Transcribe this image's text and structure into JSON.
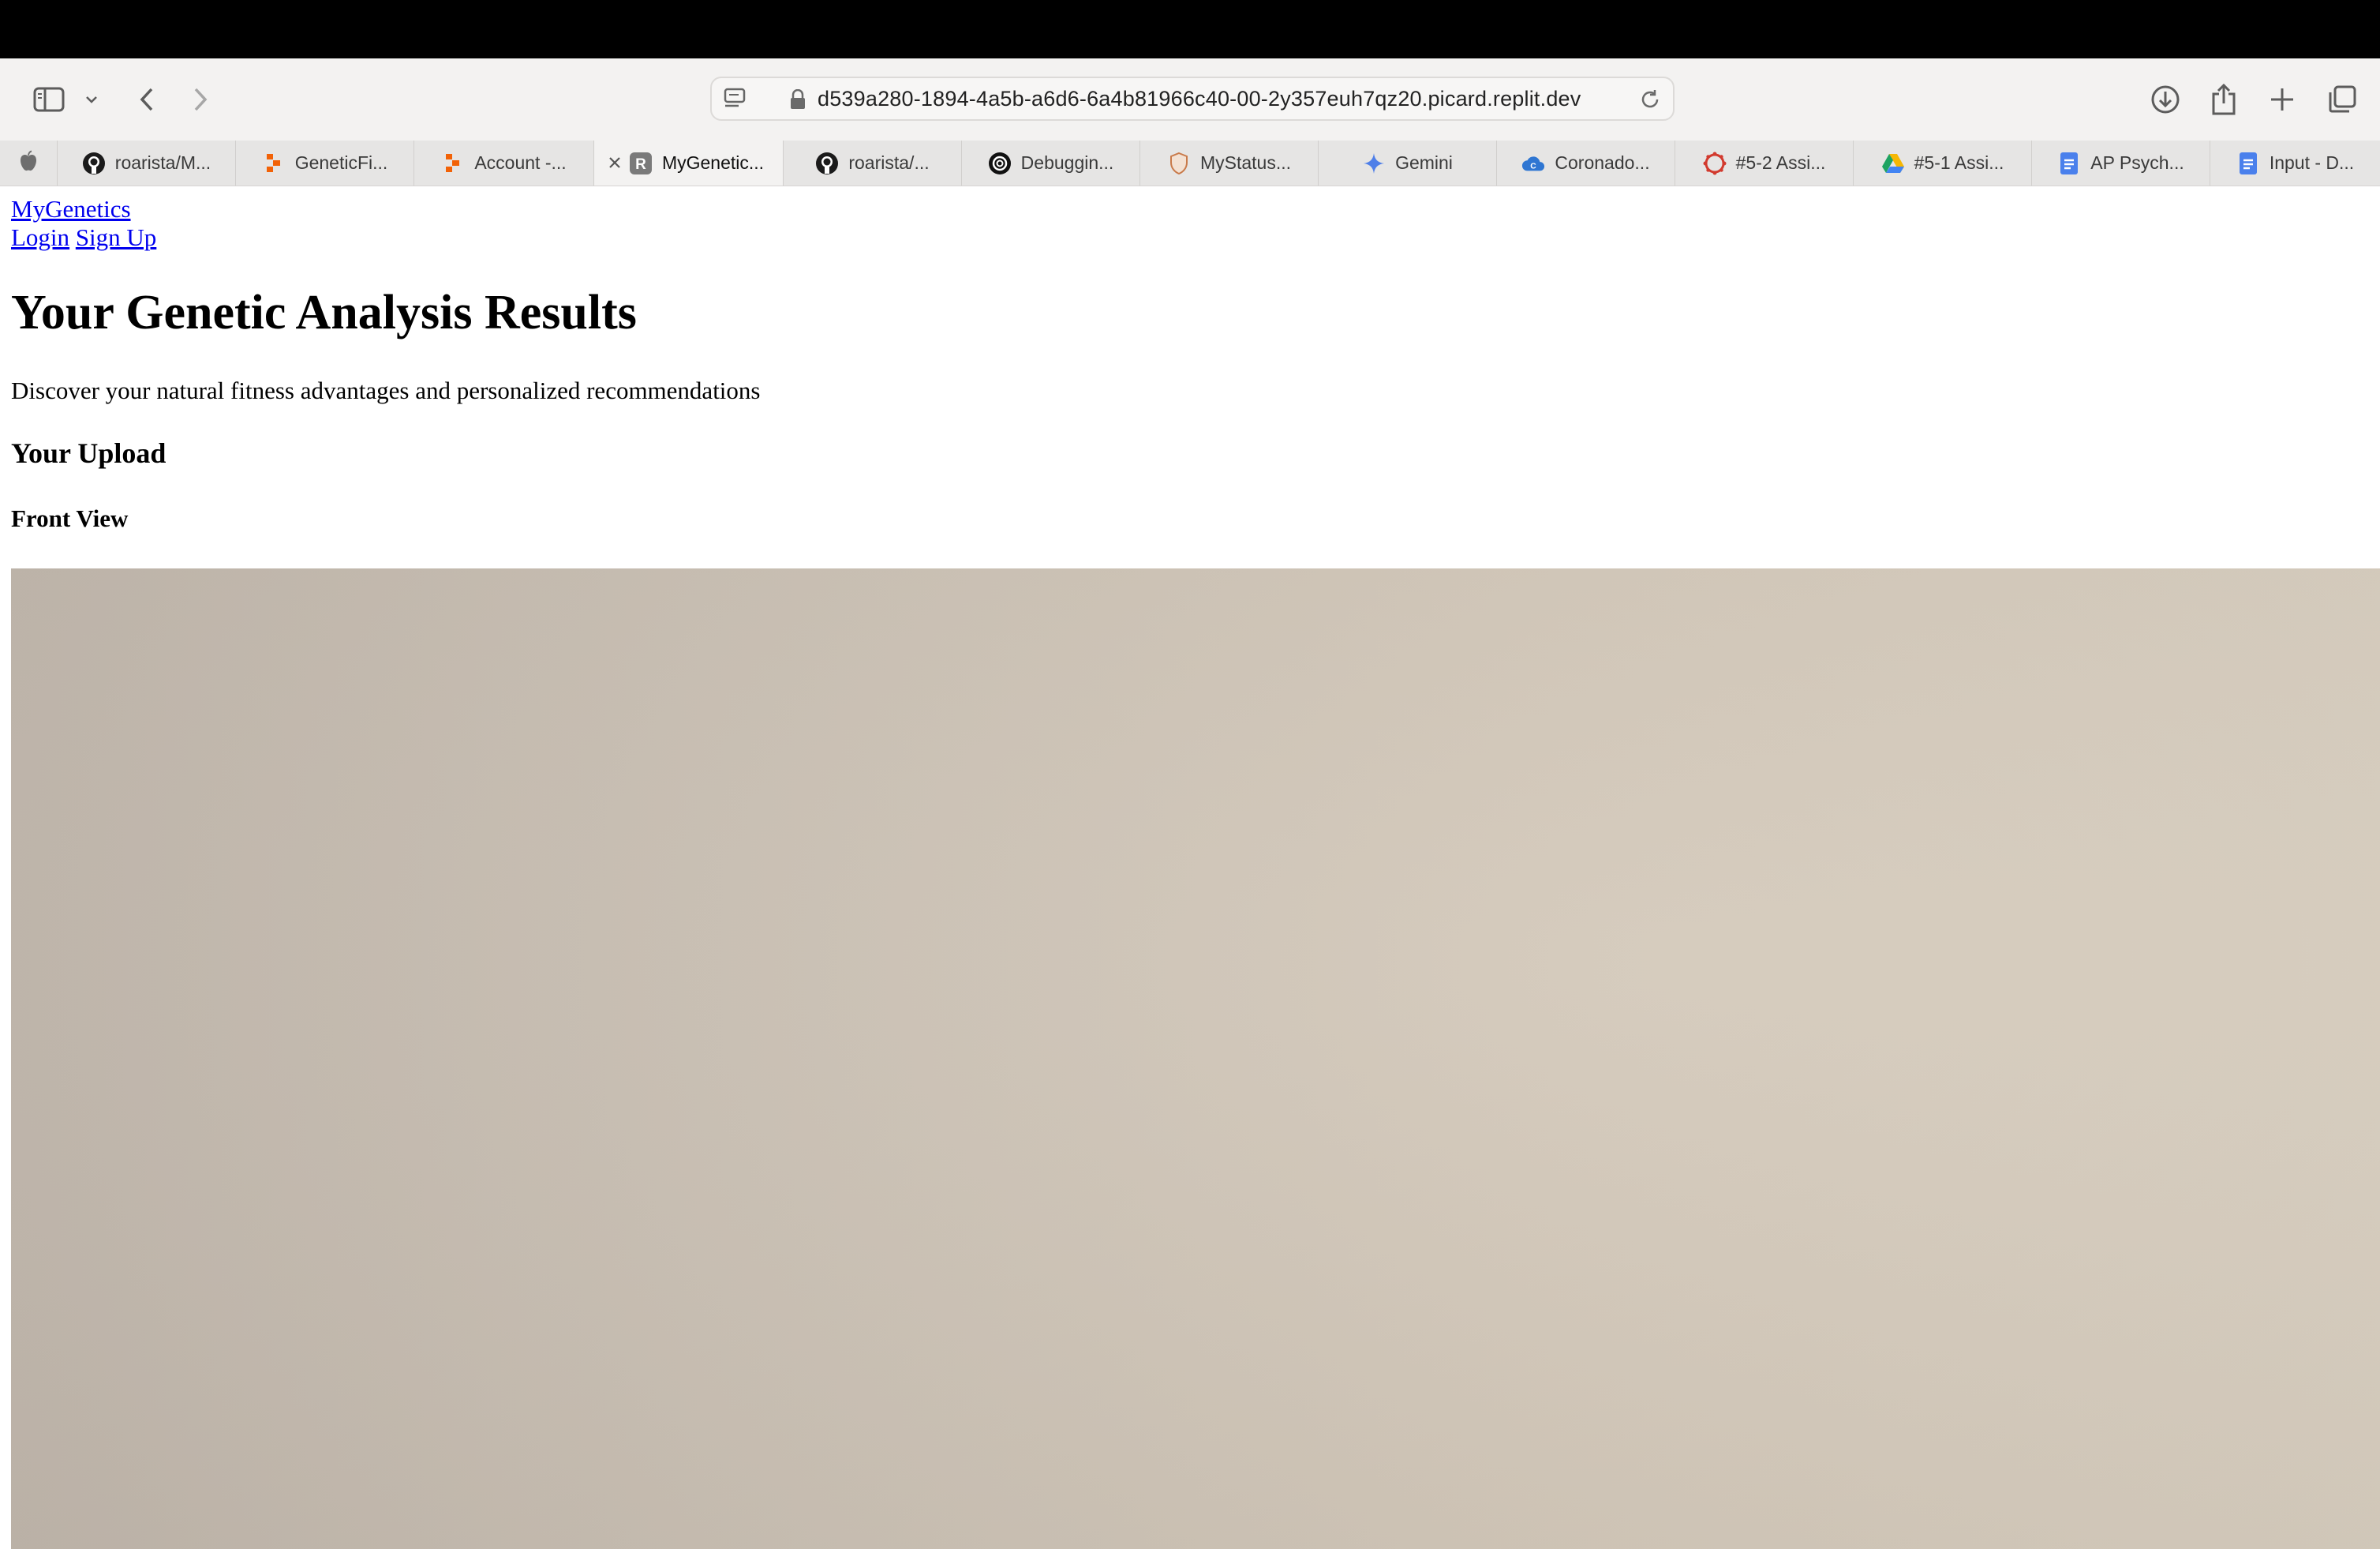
{
  "browser": {
    "url": "d539a280-1894-4a5b-a6d6-6a4b81966c40-00-2y357euh7qz20.picard.replit.dev",
    "tabs": [
      {
        "title": "roarista/M...",
        "icon": "github-icon"
      },
      {
        "title": "GeneticFi...",
        "icon": "replit-icon"
      },
      {
        "title": "Account -...",
        "icon": "replit-icon"
      },
      {
        "title": "MyGenetic...",
        "icon": "replit-r-icon",
        "active": true
      },
      {
        "title": "roarista/...",
        "icon": "github-icon"
      },
      {
        "title": "Debuggin...",
        "icon": "openai-icon"
      },
      {
        "title": "MyStatus...",
        "icon": "shield-icon"
      },
      {
        "title": "Gemini",
        "icon": "gemini-icon"
      },
      {
        "title": "Coronado...",
        "icon": "cloud-icon"
      },
      {
        "title": "#5-2 Assi...",
        "icon": "canvas-icon"
      },
      {
        "title": "#5-1 Assi...",
        "icon": "drive-icon"
      },
      {
        "title": "AP Psych...",
        "icon": "docs-icon"
      },
      {
        "title": "Input - D...",
        "icon": "docs-icon"
      }
    ]
  },
  "site": {
    "brand": "MyGenetics",
    "nav": {
      "login": "Login",
      "signup": "Sign Up"
    }
  },
  "main": {
    "title": "Your Genetic Analysis Results",
    "subtitle": "Discover your natural fitness advantages and personalized recommendations",
    "upload_heading": "Your Upload",
    "front_view_label": "Front View"
  }
}
